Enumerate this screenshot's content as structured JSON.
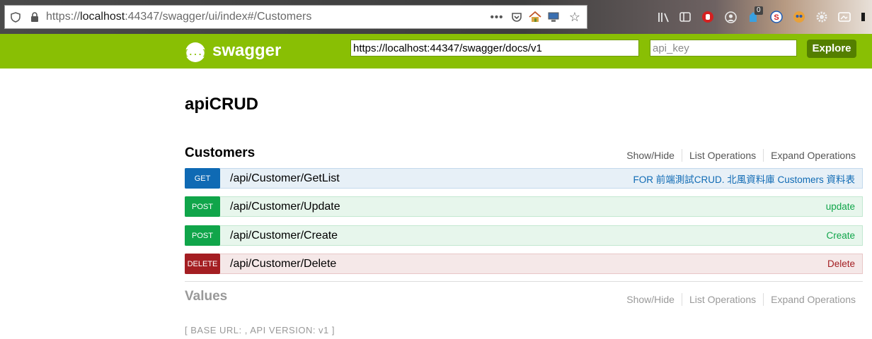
{
  "browser": {
    "url_prefix": "https://",
    "url_host": "localhost",
    "url_rest": ":44347/swagger/ui/index#/Customers",
    "badge_count": "0"
  },
  "header": {
    "logo_text": "swagger",
    "logo_glyph": "{...}",
    "url_value": "https://localhost:44347/swagger/docs/v1",
    "api_key_placeholder": "api_key",
    "explore_label": "Explore",
    "brand_color": "#89bf04"
  },
  "api": {
    "title": "apiCRUD"
  },
  "sections": [
    {
      "name": "Customers",
      "links": [
        "Show/Hide",
        "List Operations",
        "Expand Operations"
      ],
      "operations": [
        {
          "method": "GET",
          "path": "/api/Customer/GetList",
          "summary": "FOR 前端測試CRUD. 北風資料庫 Customers 資料表"
        },
        {
          "method": "POST",
          "path": "/api/Customer/Update",
          "summary": "update"
        },
        {
          "method": "POST",
          "path": "/api/Customer/Create",
          "summary": "Create"
        },
        {
          "method": "DELETE",
          "path": "/api/Customer/Delete",
          "summary": "Delete"
        }
      ]
    },
    {
      "name": "Values",
      "links": [
        "Show/Hide",
        "List Operations",
        "Expand Operations"
      ]
    }
  ],
  "footer": {
    "text": "[ BASE URL: , API VERSION: v1 ]"
  },
  "colors": {
    "get": "#0f6ab4",
    "post": "#10a54a",
    "delete": "#a41e22"
  }
}
